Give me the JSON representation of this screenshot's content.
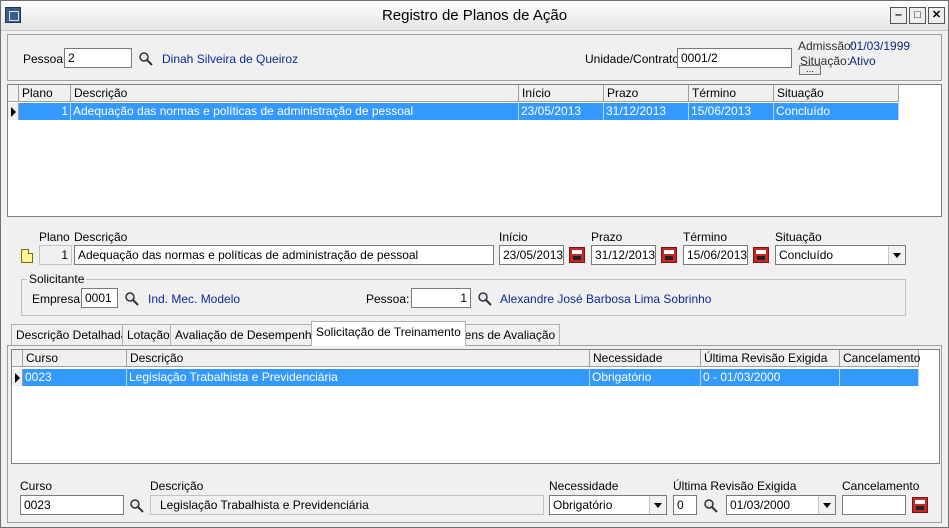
{
  "window": {
    "title": "Registro de Planos de Ação",
    "minimize": "‒",
    "maximize": "□",
    "close": "✕"
  },
  "header": {
    "pessoa_label": "Pessoa:",
    "pessoa_value": "2",
    "pessoa_name": "Dinah Silveira de Queiroz",
    "unidade_label": "Unidade/Contrato:",
    "unidade_value": "0001/2",
    "admissao_label": "Admissão:",
    "admissao_value": "01/03/1999",
    "situacao_label": "Situação:",
    "situacao_value": "Ativo",
    "ellipsis": "..."
  },
  "plans_grid": {
    "columns": [
      "Plano",
      "Descrição",
      "Início",
      "Prazo",
      "Término",
      "Situação"
    ],
    "rows": [
      [
        "1",
        "Adequação das normas e políticas de administração de pessoal",
        "23/05/2013",
        "31/12/2013",
        "15/06/2013",
        "Concluído"
      ]
    ]
  },
  "plan_form": {
    "plano_label": "Plano",
    "plano_value": "1",
    "descricao_label": "Descrição",
    "descricao_value": "Adequação das normas e políticas de administração de pessoal",
    "inicio_label": "Início",
    "inicio_value": "23/05/2013",
    "prazo_label": "Prazo",
    "prazo_value": "31/12/2013",
    "termino_label": "Término",
    "termino_value": "15/06/2013",
    "situacao_label": "Situação",
    "situacao_value": "Concluído"
  },
  "solicitante": {
    "group_label": "Solicitante",
    "empresa_label": "Empresa:",
    "empresa_value": "0001",
    "empresa_name": "Ind. Mec. Modelo",
    "pessoa_label": "Pessoa:",
    "pessoa_value": "1",
    "pessoa_name": "Alexandre José Barbosa Lima Sobrinho"
  },
  "tabs": [
    {
      "label": "Descrição Detalhada"
    },
    {
      "label": "Lotação"
    },
    {
      "label": "Avaliação de Desempenho"
    },
    {
      "label": "Solicitação de Treinamento"
    },
    {
      "label": "Itens de Avaliação"
    }
  ],
  "training_grid": {
    "columns": [
      "Curso",
      "Descrição",
      "Necessidade",
      "Última Revisão Exigida",
      "Cancelamento"
    ],
    "rows": [
      [
        "0023",
        "Legislação Trabalhista e Previdenciária",
        "Obrigatório",
        "0 - 01/03/2000",
        ""
      ]
    ]
  },
  "training_form": {
    "curso_label": "Curso",
    "curso_value": "0023",
    "descricao_label": "Descrição",
    "descricao_value": "Legislação Trabalhista e Previdenciária",
    "necessidade_label": "Necessidade",
    "necessidade_value": "Obrigatório",
    "revisao_label": "Última Revisão Exigida",
    "revisao_num": "0",
    "revisao_date": "01/03/2000",
    "cancelamento_label": "Cancelamento",
    "cancelamento_value": ""
  }
}
